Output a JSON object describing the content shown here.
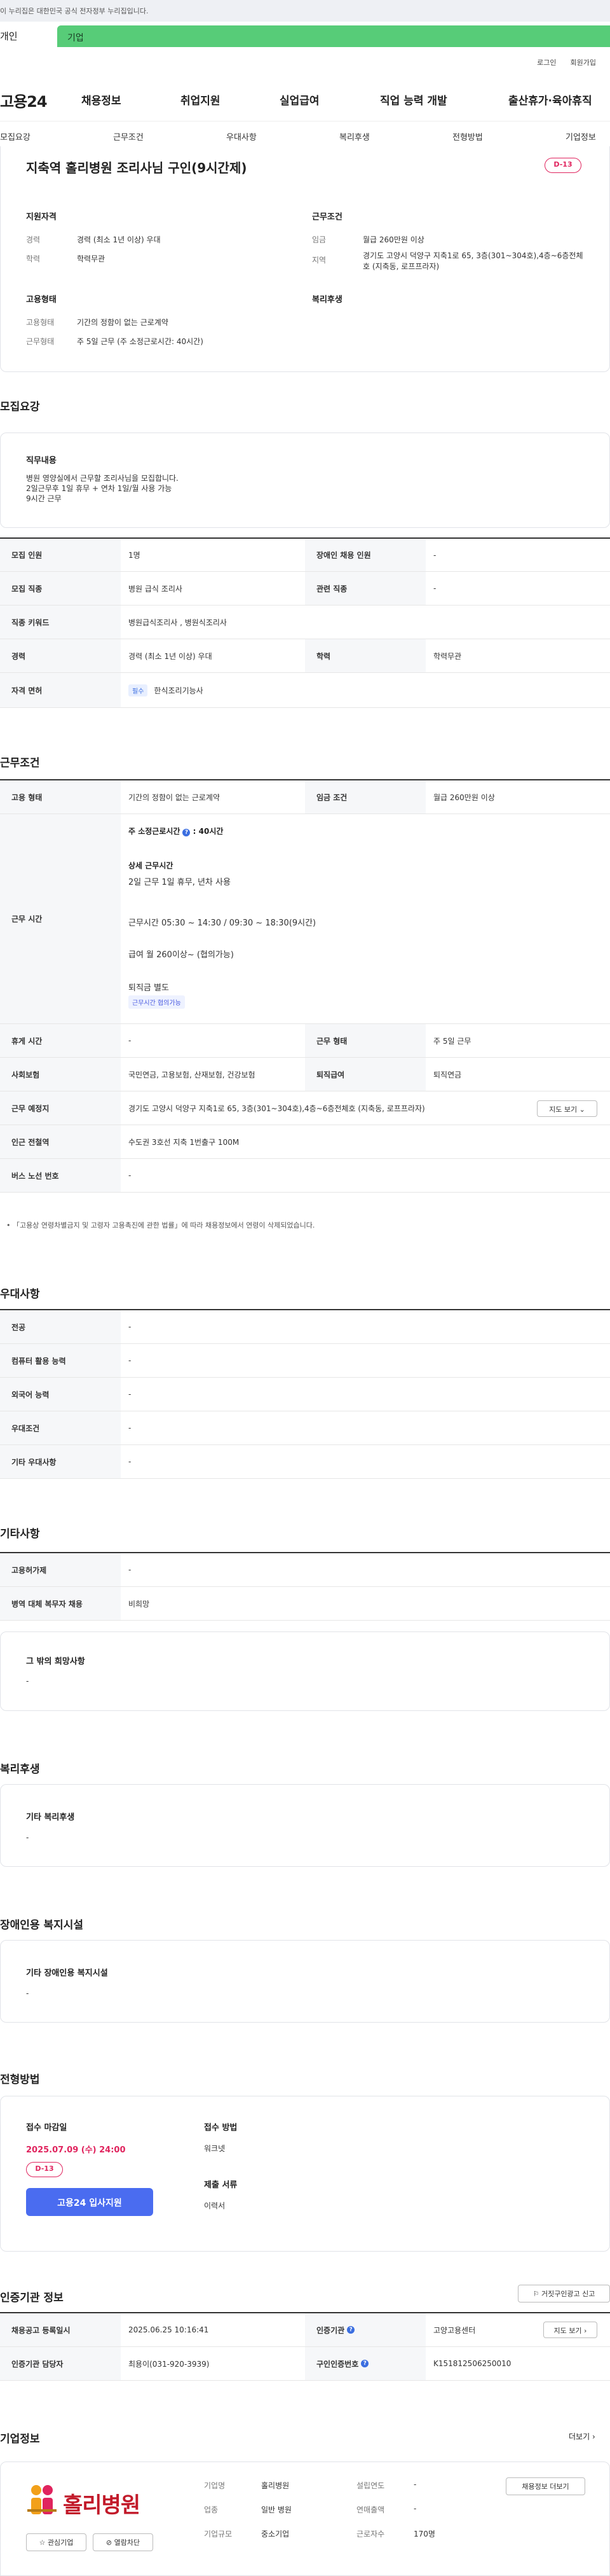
{
  "gov_banner": "이 누리집은 대한민국 공식 전자정부 누리집입니다.",
  "tabs": {
    "person": "개인",
    "company": "기업"
  },
  "util": {
    "login": "로그인",
    "join": "회원가입"
  },
  "logo": "고용24",
  "gnb": [
    "채용정보",
    "취업지원",
    "실업급여",
    "직업 능력 개발",
    "출산휴가·육아휴직"
  ],
  "subnav": [
    "모집요강",
    "근무조건",
    "우대사항",
    "복리후생",
    "전형방법",
    "기업정보"
  ],
  "job": {
    "title": "지축역 홀리병원 조리사님 구인(9시간제)",
    "dday": "D-13",
    "left_title": "지원자격",
    "career_lbl": "경력",
    "career_val": "경력 (최소 1년 이상) 우대",
    "edu_lbl": "학력",
    "edu_val": "학력무관",
    "right_title": "근무조건",
    "wage_lbl": "임금",
    "wage_val": "월급 260만원 이상",
    "area_lbl": "지역",
    "area_val": "경기도 고양시 덕양구 지축1로 65, 3층(301~304호),4층~6층전체호 (지축동, 로프프라자)",
    "emp_title": "고용형태",
    "emptype_lbl": "고용형태",
    "emptype_val": "기간의 정함이 없는 근로계약",
    "worktype_lbl": "근무형태",
    "worktype_val": "주 5일 근무 (주 소정근로시간: 40시간)",
    "welfare_title": "복리후생"
  },
  "recruit": {
    "heading": "모집요강",
    "duty_title": "직무내용",
    "duty_lines": [
      "병원 영양실에서 근무할 조리사님을 모집합니다.",
      "2일근무후 1일 휴무 + 연차 1일/월 사용 가능",
      "9시간 근무"
    ],
    "count_lbl": "모집 인원",
    "count_val": "1명",
    "disabled_lbl": "장애인 채용 인원",
    "disabled_val": "-",
    "job_lbl": "모집 직종",
    "job_val": "병원 급식 조리사",
    "related_lbl": "관련 직종",
    "related_val": "-",
    "keyword_lbl": "직종 키워드",
    "keyword_val": "병원급식조리사 , 병원식조리사",
    "career_lbl": "경력",
    "career_val": "경력 (최소 1년 이상) 우대",
    "edu_lbl": "학력",
    "edu_val": "학력무관",
    "license_lbl": "자격 면허",
    "license_tag": "필수",
    "license_val": "한식조리기능사"
  },
  "cond": {
    "heading": "근무조건",
    "emp_lbl": "고용 형태",
    "emp_val": "기간의 정함이 없는 근로계약",
    "wage_lbl": "임금 조건",
    "wage_val": "월급 260만원 이상",
    "time_lbl": "근무 시간",
    "hours_title": "주 소정근로시간",
    "hours_val": "40시간",
    "detail_title": "상세 근무시간",
    "detail_line": "2일 근무 1일 휴무, 년차 사용",
    "work_time": "근무시간  05:30 ~ 14:30 / 09:30 ~ 18:30(9시간)",
    "pay": "급여 월 260이상~ (협의가능)",
    "severance": "퇴직금 별도",
    "tag": "근무시간 협의가능",
    "rest_lbl": "휴게 시간",
    "rest_val": "-",
    "form_lbl": "근무 형태",
    "form_val": "주 5일 근무",
    "ins_lbl": "사회보험",
    "ins_val": "국민연금, 고용보험, 산재보험, 건강보험",
    "retire_lbl": "퇴직급여",
    "retire_val": "퇴직연금",
    "place_lbl": "근무 예정지",
    "place_val": "경기도 고양시 덕양구 지축1로 65, 3층(301~304호),4층~6층전체호 (지축동, 로프프라자)",
    "map_btn": "지도 보기",
    "subway_lbl": "인근 전철역",
    "subway_val": "수도권 3호선 지축 1번출구 100M",
    "bus_lbl": "버스 노선 번호",
    "bus_val": "-",
    "notice": "「고용상 연령차별금지 및 고령자 고용촉진에 관한 법률」에 따라 채용정보에서 연령이 삭제되었습니다."
  },
  "pref": {
    "heading": "우대사항",
    "rows": [
      {
        "label": "전공",
        "value": "-"
      },
      {
        "label": "컴퓨터 활용 능력",
        "value": "-"
      },
      {
        "label": "외국어 능력",
        "value": "-"
      },
      {
        "label": "우대조건",
        "value": "-"
      },
      {
        "label": "기타 우대사항",
        "value": "-"
      }
    ]
  },
  "etc": {
    "heading": "기타사항",
    "rows": [
      {
        "label": "고용허가제",
        "value": "-"
      },
      {
        "label": "병역 대체 복무자 채용",
        "value": "비희망"
      }
    ],
    "other_title": "그 밖의 희망사항",
    "other_val": "-"
  },
  "welfare": {
    "heading": "복리후생",
    "title": "기타 복리후생",
    "val": "-"
  },
  "disabled_fac": {
    "heading": "장애인용 복지시설",
    "title": "기타 장애인용 복지시설",
    "val": "-"
  },
  "process": {
    "heading": "전형방법",
    "deadline_title": "접수 마감일",
    "deadline_val": "2025.07.09 (수) 24:00",
    "dday": "D-13",
    "apply_btn": "고용24 입사지원",
    "method_title": "접수 방법",
    "method_val": "워크넷",
    "docs_title": "제출 서류",
    "docs_val": "이력서"
  },
  "cert": {
    "heading": "인증기관 정보",
    "report_btn": "거짓구인광고 신고",
    "reg_lbl": "채용공고 등록일시",
    "reg_val": "2025.06.25 10:16:41",
    "org_lbl": "인증기관",
    "org_val": "고양고용센터",
    "map_btn": "지도 보기",
    "mgr_lbl": "인증기관 담당자",
    "mgr_val": "최용이(031-920-3939)",
    "num_lbl": "구인인증번호",
    "num_val": "K151812506250010"
  },
  "company": {
    "heading": "기업정보",
    "more": "더보기",
    "logo_text": "홀리병원",
    "fav_btn": "관심기업",
    "block_btn": "열람차단",
    "name_lbl": "기업명",
    "name_val": "홀리병원",
    "ind_lbl": "업종",
    "ind_val": "일반 병원",
    "size_lbl": "기업규모",
    "size_val": "중소기업",
    "est_lbl": "설립연도",
    "est_val": "-",
    "sales_lbl": "연매출액",
    "sales_val": "-",
    "emp_lbl": "근로자수",
    "emp_val": "170명",
    "view_btn": "채용정보 더보기"
  },
  "colors": {
    "green": "#57cc78",
    "red": "#e0245e",
    "blue": "#4a6cf0"
  }
}
